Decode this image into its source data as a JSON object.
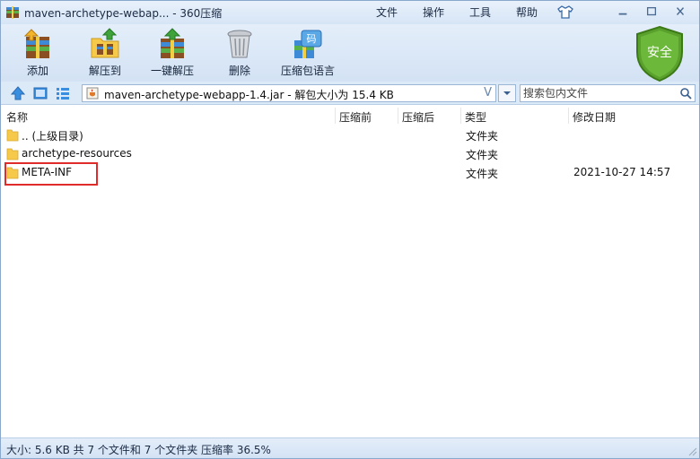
{
  "window": {
    "title": "maven-archetype-webap... - 360压缩"
  },
  "menu": [
    {
      "label": "文件"
    },
    {
      "label": "操作"
    },
    {
      "label": "工具"
    },
    {
      "label": "帮助"
    }
  ],
  "toolbar": {
    "add_label": "添加",
    "extract_to_label": "解压到",
    "one_click_extract_label": "一键解压",
    "delete_label": "删除",
    "password_label": "压缩包语言",
    "password_badge": "码",
    "security_label": "安全"
  },
  "address": {
    "path": "maven-archetype-webapp-1.4.jar - 解包大小为 15.4 KB",
    "history_glyph": "V",
    "search_placeholder": "搜索包内文件"
  },
  "columns": {
    "name": "名称",
    "compressed_before": "压缩前",
    "compressed_after": "压缩后",
    "type": "类型",
    "modified": "修改日期"
  },
  "rows": [
    {
      "name": ".. (上级目录)",
      "before": "",
      "after": "",
      "type": "文件夹",
      "modified": ""
    },
    {
      "name": "archetype-resources",
      "before": "",
      "after": "",
      "type": "文件夹",
      "modified": ""
    },
    {
      "name": "META-INF",
      "before": "",
      "after": "",
      "type": "文件夹",
      "modified": "2021-10-27 14:57"
    }
  ],
  "status": {
    "text": "大小: 5.6 KB 共 7 个文件和 7 个文件夹 压缩率 36.5%"
  },
  "colors": {
    "accent": "#3a78c2",
    "highlight": "#e02b2b",
    "folder": "#f6c94a",
    "shield": "#5aa02c"
  }
}
